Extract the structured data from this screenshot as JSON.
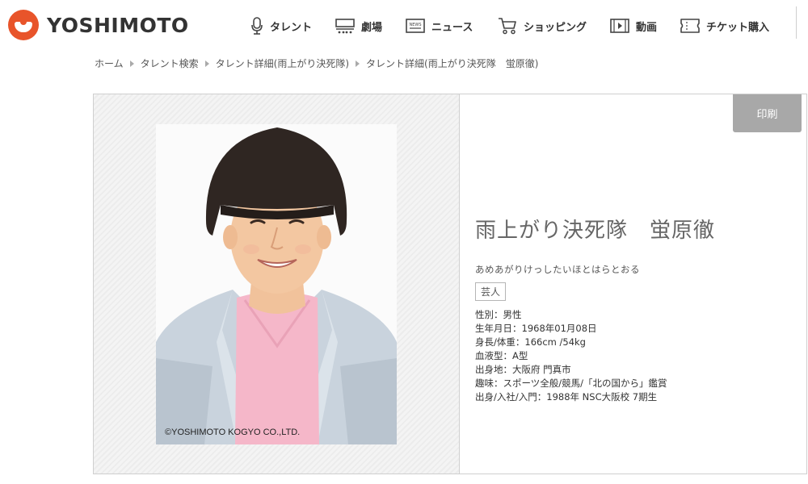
{
  "header": {
    "logo_text": "YOSHIMOTO",
    "nav": [
      {
        "label": "タレント",
        "icon": "microphone-icon"
      },
      {
        "label": "劇場",
        "icon": "theater-icon"
      },
      {
        "label": "ニュース",
        "icon": "news-icon"
      },
      {
        "label": "ショッピング",
        "icon": "cart-icon"
      },
      {
        "label": "動画",
        "icon": "video-icon"
      },
      {
        "label": "チケット購入",
        "icon": "ticket-icon"
      }
    ],
    "news_icon_text": "NEWS"
  },
  "breadcrumb": [
    "ホーム",
    "タレント検索",
    "タレント詳細(雨上がり決死隊)",
    "タレント詳細(雨上がり決死隊　蛍原徹)"
  ],
  "profile": {
    "photo_copyright": "©YOSHIMOTO KOGYO CO.,LTD.",
    "print_label": "印刷",
    "name": "雨上がり決死隊　蛍原徹",
    "reading": "あめあがりけっしたいほとはらとおる",
    "category": "芸人",
    "facts": [
      "性別：男性",
      "生年月日：1968年01月08日",
      "身長/体重：166cm /54kg",
      "血液型：A型",
      "出身地：大阪府 門真市",
      "趣味：スポーツ全般/競馬/「北の国から」鑑賞",
      "出身/入社/入門：1988年 NSC大阪校 7期生"
    ]
  },
  "colors": {
    "brand": "#e8542a",
    "print_button": "#a8a8a8"
  }
}
